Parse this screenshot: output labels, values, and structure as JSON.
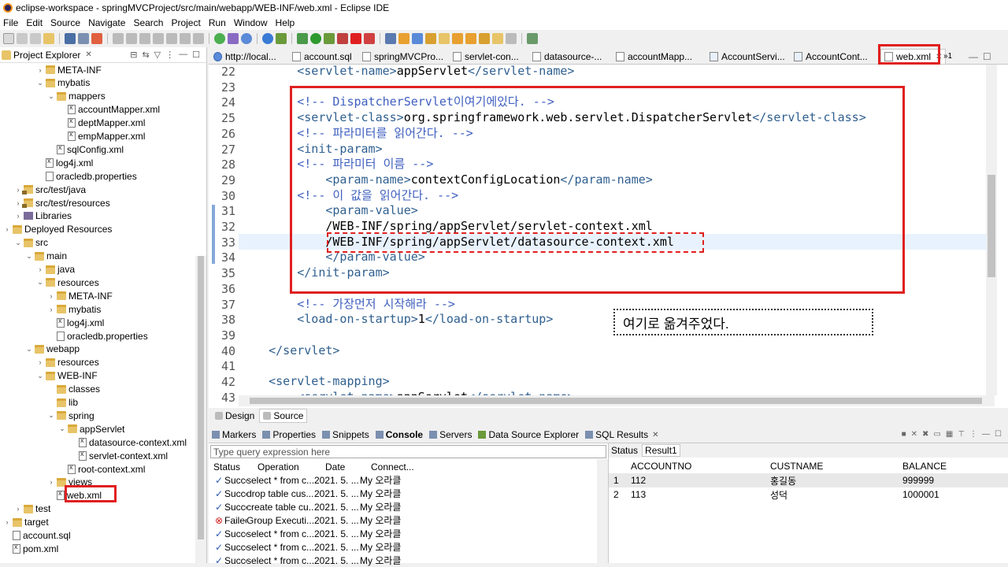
{
  "window": {
    "title": "eclipse-workspace - springMVCProject/src/main/webapp/WEB-INF/web.xml - Eclipse IDE"
  },
  "menu": [
    "File",
    "Edit",
    "Source",
    "Navigate",
    "Search",
    "Project",
    "Run",
    "Window",
    "Help"
  ],
  "explorer": {
    "title": "Project Explorer",
    "items": [
      {
        "label": "META-INF",
        "icon": "folder-icon",
        "twisty": "›"
      },
      {
        "label": "mybatis",
        "icon": "folder-icon",
        "twisty": "⌄"
      },
      {
        "label": "mappers",
        "icon": "folder-icon",
        "twisty": "⌄"
      },
      {
        "label": "accountMapper.xml",
        "icon": "xml-file-icon",
        "twisty": ""
      },
      {
        "label": "deptMapper.xml",
        "icon": "xml-file-icon",
        "twisty": ""
      },
      {
        "label": "empMapper.xml",
        "icon": "xml-file-icon",
        "twisty": ""
      },
      {
        "label": "sqlConfig.xml",
        "icon": "xml-file-icon",
        "twisty": ""
      },
      {
        "label": "log4j.xml",
        "icon": "xml-file-icon",
        "twisty": ""
      },
      {
        "label": "oracledb.properties",
        "icon": "properties-file-icon",
        "twisty": ""
      },
      {
        "label": "src/test/java",
        "icon": "source-folder-icon",
        "twisty": "›"
      },
      {
        "label": "src/test/resources",
        "icon": "source-folder-icon",
        "twisty": "›"
      },
      {
        "label": "Libraries",
        "icon": "library-icon",
        "twisty": "›"
      },
      {
        "label": "Deployed Resources",
        "icon": "folder-icon",
        "twisty": "›"
      },
      {
        "label": "src",
        "icon": "folder-icon",
        "twisty": "⌄"
      },
      {
        "label": "main",
        "icon": "folder-icon",
        "twisty": "⌄"
      },
      {
        "label": "java",
        "icon": "folder-icon",
        "twisty": "›"
      },
      {
        "label": "resources",
        "icon": "folder-icon",
        "twisty": "⌄"
      },
      {
        "label": "META-INF",
        "icon": "folder-icon",
        "twisty": "›"
      },
      {
        "label": "mybatis",
        "icon": "folder-icon",
        "twisty": "›"
      },
      {
        "label": "log4j.xml",
        "icon": "xml-file-icon",
        "twisty": ""
      },
      {
        "label": "oracledb.properties",
        "icon": "properties-file-icon",
        "twisty": ""
      },
      {
        "label": "webapp",
        "icon": "folder-icon",
        "twisty": "⌄"
      },
      {
        "label": "resources",
        "icon": "folder-icon",
        "twisty": "›"
      },
      {
        "label": "WEB-INF",
        "icon": "folder-icon",
        "twisty": "⌄"
      },
      {
        "label": "classes",
        "icon": "folder-icon",
        "twisty": ""
      },
      {
        "label": "lib",
        "icon": "folder-icon",
        "twisty": ""
      },
      {
        "label": "spring",
        "icon": "folder-icon",
        "twisty": "⌄"
      },
      {
        "label": "appServlet",
        "icon": "folder-icon",
        "twisty": "⌄"
      },
      {
        "label": "datasource-context.xml",
        "icon": "xml-file-icon",
        "twisty": ""
      },
      {
        "label": "servlet-context.xml",
        "icon": "xml-file-icon",
        "twisty": ""
      },
      {
        "label": "root-context.xml",
        "icon": "xml-file-icon",
        "twisty": ""
      },
      {
        "label": "views",
        "icon": "folder-icon",
        "twisty": "›"
      },
      {
        "label": "web.xml",
        "icon": "xml-file-icon",
        "twisty": ""
      },
      {
        "label": "test",
        "icon": "folder-icon",
        "twisty": "›"
      },
      {
        "label": "target",
        "icon": "folder-icon",
        "twisty": "›"
      },
      {
        "label": "account.sql",
        "icon": "sql-file-icon",
        "twisty": ""
      },
      {
        "label": "pom.xml",
        "icon": "xml-file-icon",
        "twisty": ""
      }
    ]
  },
  "editor_tabs": [
    "http://local...",
    "account.sql",
    "springMVCPro...",
    "servlet-con...",
    "datasource-...",
    "accountMapp...",
    "AccountServi...",
    "AccountCont...",
    "web.xml"
  ],
  "editor_tabs_overflow": "»1",
  "code": {
    "line_numbers": [
      "22",
      "23",
      "24",
      "25",
      "26",
      "27",
      "28",
      "29",
      "30",
      "31",
      "32",
      "33",
      "34",
      "35",
      "36",
      "37",
      "38",
      "39",
      "40",
      "41",
      "42",
      "43"
    ],
    "lines": [
      "        <servlet-name>appServlet</servlet-name>",
      "",
      "        <!-- DispatcherServlet이여기에있다. -->",
      "        <servlet-class>org.springframework.web.servlet.DispatcherServlet</servlet-class>",
      "        <!-- 파라미터를 읽어간다. -->",
      "        <init-param>",
      "        <!-- 파라미터 이름 -->",
      "            <param-name>contextConfigLocation</param-name>",
      "        <!-- 이 값을 읽어간다. -->",
      "            <param-value>",
      "            /WEB-INF/spring/appServlet/servlet-context.xml",
      "            /WEB-INF/spring/appServlet/datasource-context.xml",
      "            </param-value>",
      "        </init-param>",
      "",
      "        <!-- 가장먼저 시작해라 -->",
      "        <load-on-startup>1</load-on-startup>",
      "",
      "    </servlet>",
      "",
      "    <servlet-mapping>",
      "        <servlet-name>appServlet</servlet-name>"
    ]
  },
  "source_tabs": {
    "design": "Design",
    "source": "Source"
  },
  "bottom_tabs": [
    "Markers",
    "Properties",
    "Snippets",
    "Console",
    "Servers",
    "Data Source Explorer",
    "SQL Results"
  ],
  "query": {
    "placeholder": "Type query expression here",
    "headers": [
      "Status",
      "Operation",
      "Date",
      "Connect..."
    ],
    "rows": [
      {
        "status": "Succe",
        "operation": "select * from c...",
        "date": "2021. 5. ...",
        "conn": "My 오라클",
        "ok": true
      },
      {
        "status": "Succe",
        "operation": "drop table cus...",
        "date": "2021. 5. ...",
        "conn": "My 오라클",
        "ok": true
      },
      {
        "status": "Succe",
        "operation": "create table cu...",
        "date": "2021. 5. ...",
        "conn": "My 오라클",
        "ok": true
      },
      {
        "status": "Failec",
        "operation": "Group Executi...",
        "date": "2021. 5. ...",
        "conn": "My 오라클",
        "ok": false
      },
      {
        "status": "Succe",
        "operation": "select * from c...",
        "date": "2021. 5. ...",
        "conn": "My 오라클",
        "ok": true
      },
      {
        "status": "Succe",
        "operation": "select * from c...",
        "date": "2021. 5. ...",
        "conn": "My 오라클",
        "ok": true
      },
      {
        "status": "Succe",
        "operation": "select * from c...",
        "date": "2021. 5. ...",
        "conn": "My 오라클",
        "ok": true
      }
    ]
  },
  "results": {
    "tabs": [
      "Status",
      "Result1"
    ],
    "headers": [
      "ACCOUNTNO",
      "CUSTNAME",
      "BALANCE"
    ],
    "rows": [
      {
        "n": "1",
        "accountno": "112",
        "custname": "홍길동",
        "balance": "999999"
      },
      {
        "n": "2",
        "accountno": "113",
        "custname": "성덕",
        "balance": "1000001"
      }
    ]
  },
  "annotation": {
    "note": "여기로 옮겨주었다."
  },
  "colors": {
    "annotation_red": "#e02020",
    "tag": "#2f5f8f",
    "comment": "#3f5fbf"
  }
}
